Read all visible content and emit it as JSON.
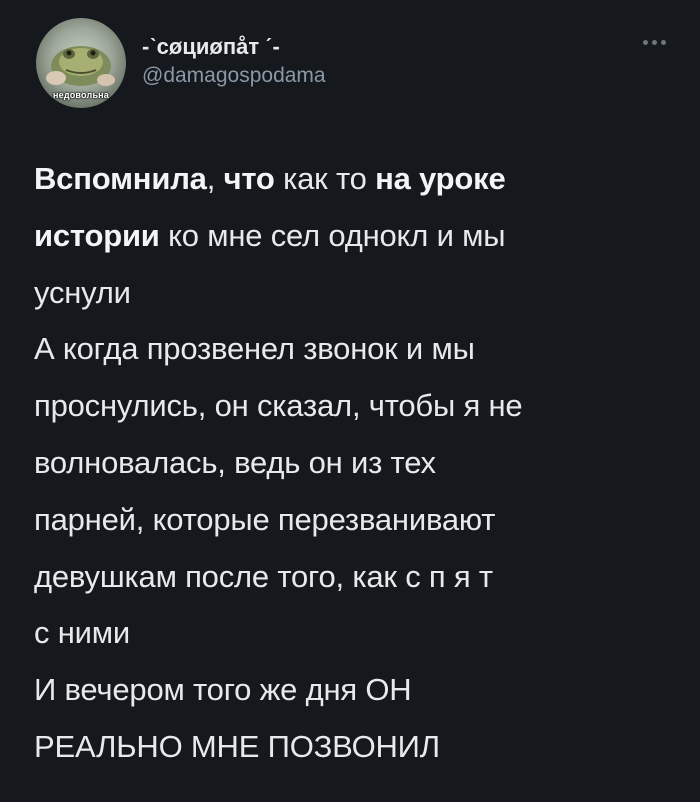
{
  "tweet": {
    "author": {
      "display_name": "-ˋсøциøпåт ˊ-",
      "handle": "@damagospodama",
      "avatar_caption": "недовольна",
      "avatar_icon": "toad-photo"
    },
    "more_icon": "more-horizontal-icon",
    "text": {
      "line1": {
        "part1": "Вспомнила",
        "part2": ", ",
        "part3": "что",
        "part4": " как то ",
        "part5": "на уроке"
      },
      "line2": {
        "part1": "истории",
        "part2": " ко мне сел однокл и мы"
      },
      "line3": "уснули",
      "line4": "А когда прозвенел звонок и мы",
      "line5": "проснулись, он сказал, чтобы я не",
      "line6": "волновалась, ведь он из тех",
      "line7": "парней, которые перезванивают",
      "line8": "девушкам после того, как  с п я т",
      "line9": "с ними",
      "line10": "И вечером того же дня ОН",
      "line11": "РЕАЛЬНО МНЕ ПОЗВОНИЛ"
    }
  },
  "colors": {
    "background": "#15181d",
    "primary_text": "#e7e9ea",
    "secondary_text": "#8b98a5"
  }
}
